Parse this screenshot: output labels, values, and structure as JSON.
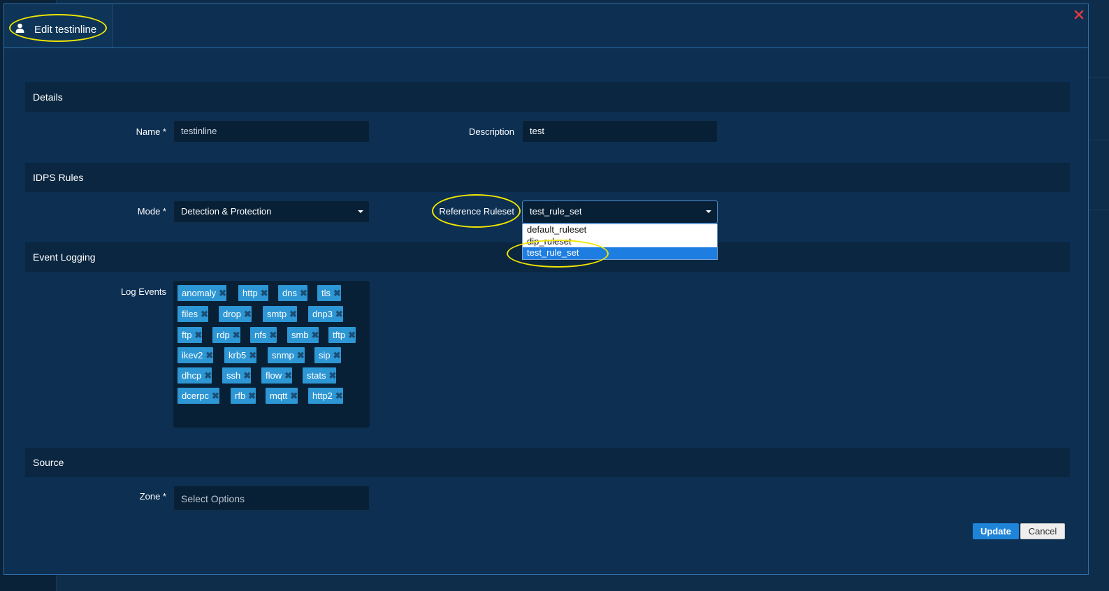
{
  "modal": {
    "title": "Edit testinline"
  },
  "sections": {
    "details": "Details",
    "idps_rules": "IDPS Rules",
    "event_logging": "Event Logging",
    "source": "Source"
  },
  "details": {
    "name_label": "Name *",
    "name_value": "testinline",
    "description_label": "Description",
    "description_value": "test"
  },
  "idps": {
    "mode_label": "Mode *",
    "mode_value": "Detection & Protection",
    "ruleset_label": "Reference Ruleset",
    "ruleset_value": "test_rule_set",
    "ruleset_options": [
      "default_ruleset",
      "dip_ruleset",
      "test_rule_set"
    ],
    "ruleset_selected_index": 2
  },
  "logging": {
    "log_events_label": "Log Events",
    "tags": [
      "anomaly",
      "http",
      "dns",
      "tls",
      "files",
      "drop",
      "smtp",
      "dnp3",
      "ftp",
      "rdp",
      "nfs",
      "smb",
      "tftp",
      "ikev2",
      "krb5",
      "snmp",
      "sip",
      "dhcp",
      "ssh",
      "flow",
      "stats",
      "dcerpc",
      "rfb",
      "mqtt",
      "http2"
    ]
  },
  "source": {
    "zone_label": "Zone *",
    "zone_placeholder": "Select Options"
  },
  "buttons": {
    "update": "Update",
    "cancel": "Cancel"
  },
  "colors": {
    "accent": "#1f84d8",
    "tag": "#2d96d4",
    "highlight_ring": "#f2e600",
    "modal_bg": "#0c2f52"
  }
}
